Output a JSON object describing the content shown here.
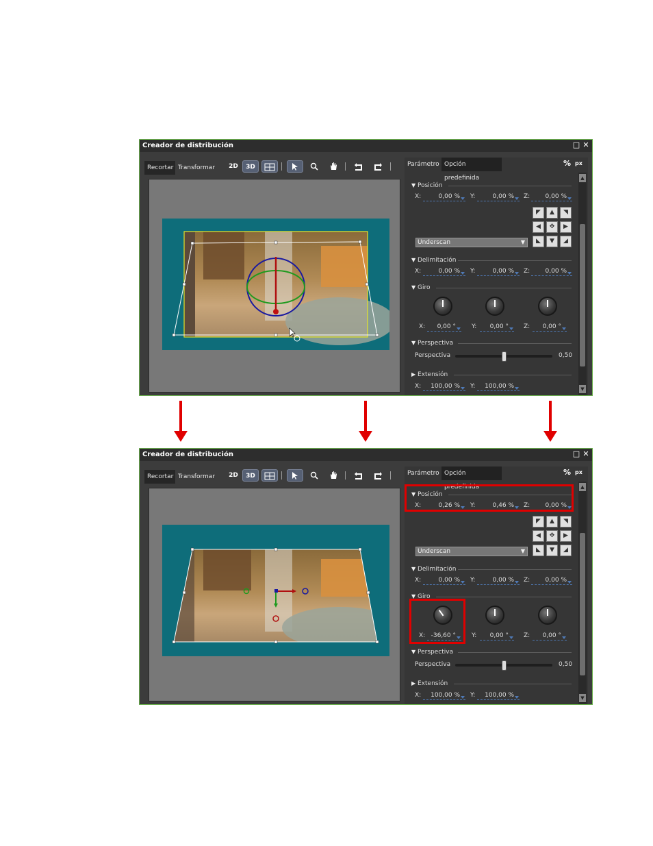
{
  "colors": {
    "annotation_red": "#e00000",
    "window_border": "#6ab04c",
    "canvas_teal": "#0e6d7a"
  },
  "window": {
    "title": "Creador de distribución",
    "maximize_icon": "□",
    "close_icon": "✕"
  },
  "left_tabs": {
    "crop": "Recortar",
    "transform": "Transformar"
  },
  "toolbar": {
    "mode_2d": "2D",
    "mode_3d": "3D",
    "grid_icon": "grid-icon",
    "select_icon": "cursor-icon",
    "zoom_icon": "magnifier-icon",
    "pan_icon": "hand-icon",
    "undo_icon": "undo-icon",
    "redo_icon": "redo-icon"
  },
  "right_tabs": {
    "parameter": "Parámetro",
    "preset": "Opción predefinida"
  },
  "units": {
    "percent": "%",
    "px": "px"
  },
  "labels": {
    "x": "X:",
    "y": "Y:",
    "z": "Z:"
  },
  "sections": {
    "position": "Posición",
    "cropping": "Delimitación",
    "rotation": "Giro",
    "perspective": "Perspectiva",
    "extension": "Extensión"
  },
  "perspective_label": "Perspectiva",
  "underscan": "Underscan",
  "before": {
    "position": {
      "x": "0,00 %",
      "y": "0,00 %",
      "z": "0,00 %"
    },
    "cropping": {
      "x": "0,00 %",
      "y": "0,00 %",
      "z": "0,00 %"
    },
    "rotation": {
      "x": "0,00 °",
      "y": "0,00 °",
      "z": "0,00 °"
    },
    "perspective_value": "0,50",
    "perspective_level": 0.5,
    "extension": {
      "x": "100,00 %",
      "y": "100,00 %"
    },
    "knob_angles": [
      0,
      0,
      0
    ]
  },
  "after": {
    "position": {
      "x": "0,26 %",
      "y": "0,46 %",
      "z": "0,00 %"
    },
    "cropping": {
      "x": "0,00 %",
      "y": "0,00 %",
      "z": "0,00 %"
    },
    "rotation": {
      "x": "-36,60 °",
      "y": "0,00 °",
      "z": "0,00 °"
    },
    "perspective_value": "0,50",
    "perspective_level": 0.5,
    "extension": {
      "x": "100,00 %",
      "y": "100,00 %"
    },
    "knob_angles": [
      -36.6,
      0,
      0
    ]
  }
}
